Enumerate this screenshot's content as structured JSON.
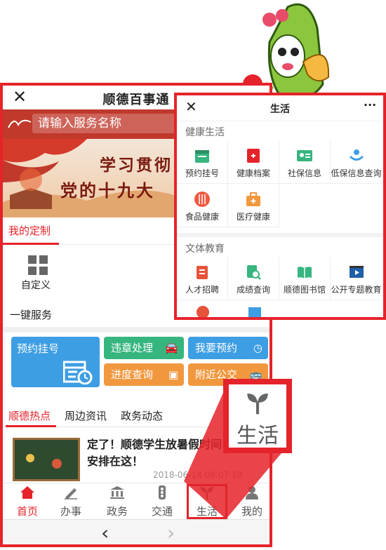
{
  "phone": {
    "title": "顺德百事通",
    "close_icon": "close-icon",
    "search_placeholder": "请输入服务名称",
    "banner_line1": "学习贯彻",
    "banner_line2": "党的十九大",
    "custom_tab": "我的定制",
    "custom_item": "自定义",
    "one_key": "一键服务",
    "tiles": {
      "big": "预约挂号",
      "t1": "违章处理",
      "t2": "我要预约",
      "t3": "进度查询",
      "t4": "附近公交"
    },
    "news_tabs": [
      "顺德热点",
      "周边资讯",
      "政务动态"
    ],
    "news": {
      "title": "定了！顺德学生放暑假时间，考试安排在这！",
      "time": "2018-06-14 08:07:18"
    },
    "tabbar": [
      "首页",
      "办事",
      "政务",
      "交通",
      "生活",
      "我的"
    ],
    "nav_back": "‹",
    "nav_forward": "›"
  },
  "popup": {
    "title": "生活",
    "more": "···",
    "section1": "健康生活",
    "section1_items": [
      "预约挂号",
      "健康档案",
      "社保信息",
      "低保信息查询",
      "食品健康",
      "医疗健康"
    ],
    "section2": "文体教育",
    "section2_items": [
      "人才招聘",
      "成绩查询",
      "顺德图书馆",
      "公开专题教育"
    ]
  },
  "zoom": {
    "label": "生活"
  },
  "colors": {
    "accent": "#e5232a",
    "blue": "#3d9ee4",
    "green": "#36b57f",
    "orange": "#f1983f"
  }
}
